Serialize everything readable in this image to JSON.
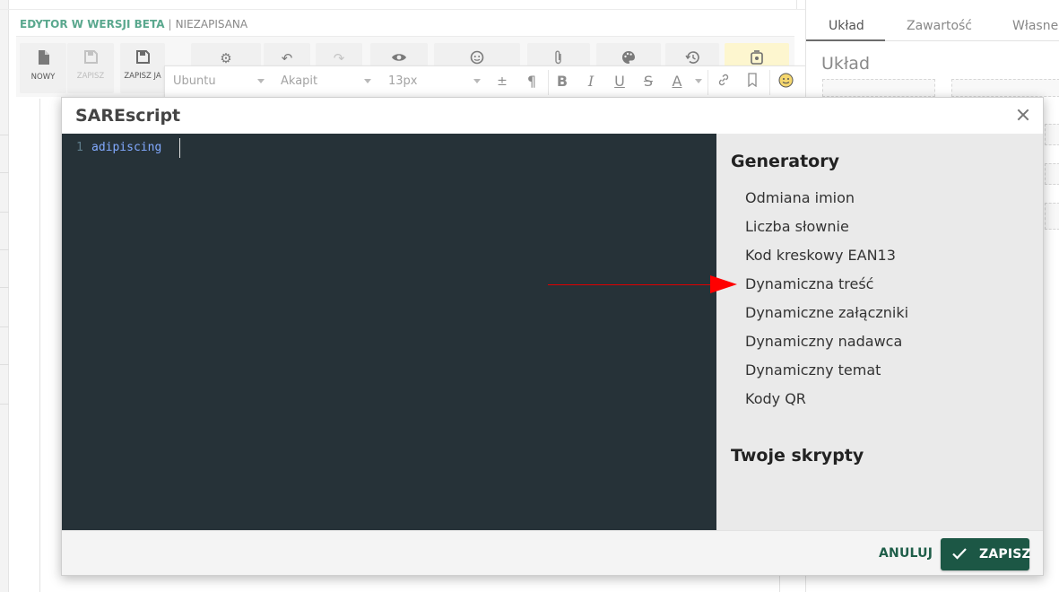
{
  "editor_header": {
    "beta_label": "EDYTOR W WERSJI BETA",
    "separator": "|",
    "status_label": "NIEZAPISANA"
  },
  "toolbar": {
    "new_label": "NOWY",
    "save_label": "ZAPISZ",
    "save_as_label": "ZAPISZ JA"
  },
  "format_bar": {
    "font_family": "Ubuntu",
    "paragraph_style": "Akapit",
    "font_size": "13px"
  },
  "right_panel": {
    "tabs": [
      "Układ",
      "Zawartość",
      "Własne"
    ],
    "heading": "Układ"
  },
  "modal": {
    "title": "SAREscript",
    "editor": {
      "line_number": "1",
      "code": "adipiscing"
    },
    "sidebar": {
      "generators_heading": "Generatory",
      "generators": [
        "Odmiana imion",
        "Liczba słownie",
        "Kod kreskowy EAN13",
        "Dynamiczna treść",
        "Dynamiczne załączniki",
        "Dynamiczny nadawca",
        "Dynamiczny temat",
        "Kody QR"
      ],
      "scripts_heading": "Twoje skrypty"
    },
    "footer": {
      "cancel_label": "ANULUJ",
      "save_label": "ZAPISZ"
    }
  },
  "annotation": {
    "arrow_color": "#ff0000"
  },
  "colors": {
    "editor_bg": "#263238",
    "code_color": "#82aaff",
    "primary_green": "#1c5745",
    "beta_green": "#5aa88e"
  }
}
